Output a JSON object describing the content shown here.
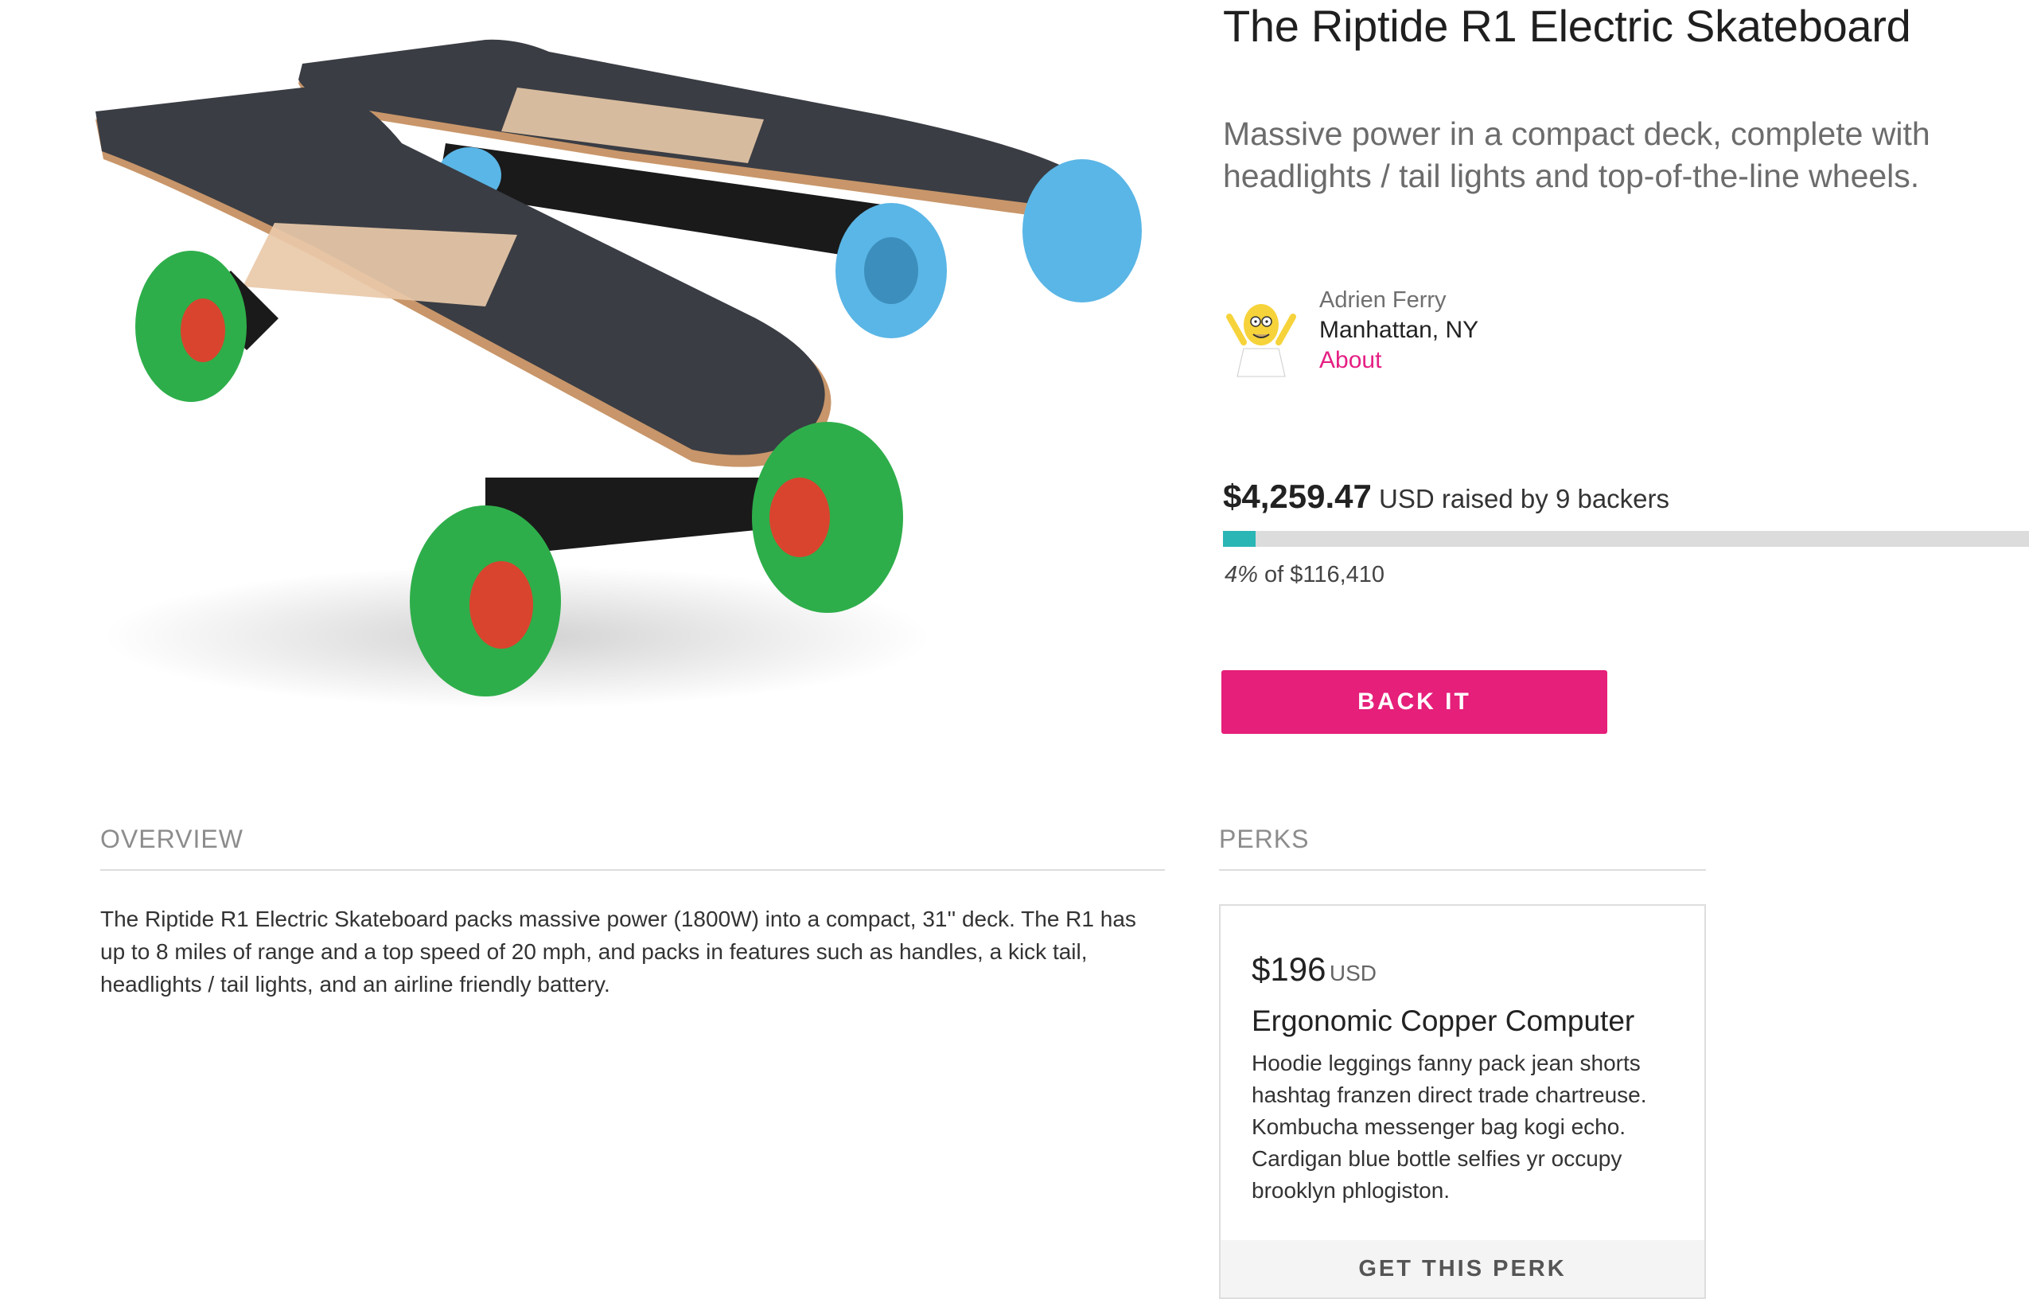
{
  "campaign": {
    "title": "The Riptide R1 Electric Skateboard",
    "subtitle": "Massive power in a compact deck, complete with headlights / tail lights and top-of-the-line wheels."
  },
  "creator": {
    "name": "Adrien Ferry",
    "location": "Manhattan, NY",
    "about_label": "About",
    "avatar_icon": "cartoon-avatar-icon"
  },
  "funding": {
    "raised_amount": "$4,259.47",
    "raised_suffix": " USD raised by 9 backers",
    "percent_label": "4%",
    "goal_suffix": " of $116,410",
    "progress_fraction": 0.04,
    "back_button_label": "BACK IT"
  },
  "colors": {
    "accent_pink": "#e51f7a",
    "progress_teal": "#2bb6b6",
    "about_link": "#e51f83"
  },
  "overview": {
    "heading": "OVERVIEW",
    "text": "The Riptide R1 Electric Skateboard packs massive power (1800W) into a compact, 31'' deck. The R1 has up to 8 miles of range and a top speed of 20 mph, and packs in features such as handles, a kick tail, headlights / tail lights, and an airline friendly battery."
  },
  "perks": {
    "heading": "PERKS",
    "items": [
      {
        "price": "$196",
        "currency": "USD",
        "name": "Ergonomic Copper Computer",
        "description": "Hoodie leggings fanny pack jean shorts hashtag franzen direct trade chartreuse. Kombucha messenger bag kogi echo. Cardigan blue bottle selfies yr occupy brooklyn phlogiston.",
        "button_label": "GET THIS PERK"
      }
    ]
  }
}
